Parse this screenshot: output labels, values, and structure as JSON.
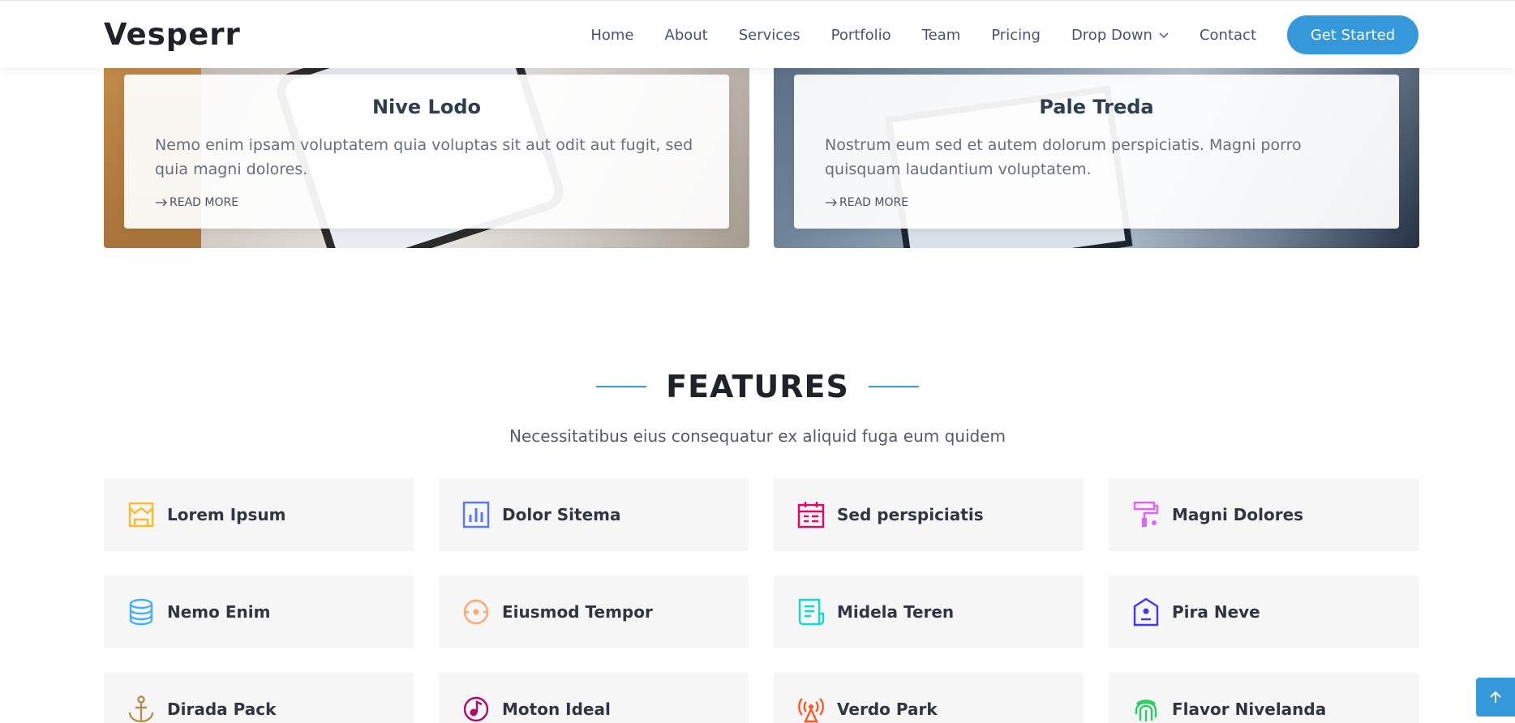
{
  "header": {
    "logo": "Vesperr",
    "nav": [
      {
        "label": "Home"
      },
      {
        "label": "About"
      },
      {
        "label": "Services"
      },
      {
        "label": "Portfolio"
      },
      {
        "label": "Team"
      },
      {
        "label": "Pricing"
      },
      {
        "label": "Drop Down"
      },
      {
        "label": "Contact"
      }
    ],
    "cta_label": "Get Started"
  },
  "blog": [
    {
      "title": "Nive Lodo",
      "text": "Nemo enim ipsam voluptatem quia voluptas sit aut odit aut fugit, sed quia magni dolores.",
      "read_more": "READ MORE"
    },
    {
      "title": "Pale Treda",
      "text": "Nostrum eum sed et autem dolorum perspiciatis. Magni porro quisquam laudantium voluptatem.",
      "read_more": "READ MORE"
    }
  ],
  "features": {
    "title": "FEATURES",
    "subtitle": "Necessitatibus eius consequatur ex aliquid fuga eum quidem",
    "accent_color": "#3498db",
    "items": [
      {
        "label": "Lorem Ipsum",
        "icon": "store-icon",
        "color": "#ffbb2c"
      },
      {
        "label": "Dolor Sitema",
        "icon": "bar-chart-icon",
        "color": "#5578ff"
      },
      {
        "label": "Sed perspiciatis",
        "icon": "calendar-icon",
        "color": "#e80368"
      },
      {
        "label": "Magni Dolores",
        "icon": "paint-roller-icon",
        "color": "#e361ff"
      },
      {
        "label": "Nemo Enim",
        "icon": "database-icon",
        "color": "#47aeff"
      },
      {
        "label": "Eiusmod Tempor",
        "icon": "gradienter-icon",
        "color": "#ffa76e"
      },
      {
        "label": "Midela Teren",
        "icon": "file-list-icon",
        "color": "#11dbcf"
      },
      {
        "label": "Pira Neve",
        "icon": "price-tag-icon",
        "color": "#4233ff"
      },
      {
        "label": "Dirada Pack",
        "icon": "anchor-icon",
        "color": "#b2904f"
      },
      {
        "label": "Moton Ideal",
        "icon": "disc-icon",
        "color": "#b20969"
      },
      {
        "label": "Verdo Park",
        "icon": "broadcast-icon",
        "color": "#ff5828"
      },
      {
        "label": "Flavor Nivelanda",
        "icon": "fingerprint-icon",
        "color": "#29cc61"
      }
    ]
  }
}
